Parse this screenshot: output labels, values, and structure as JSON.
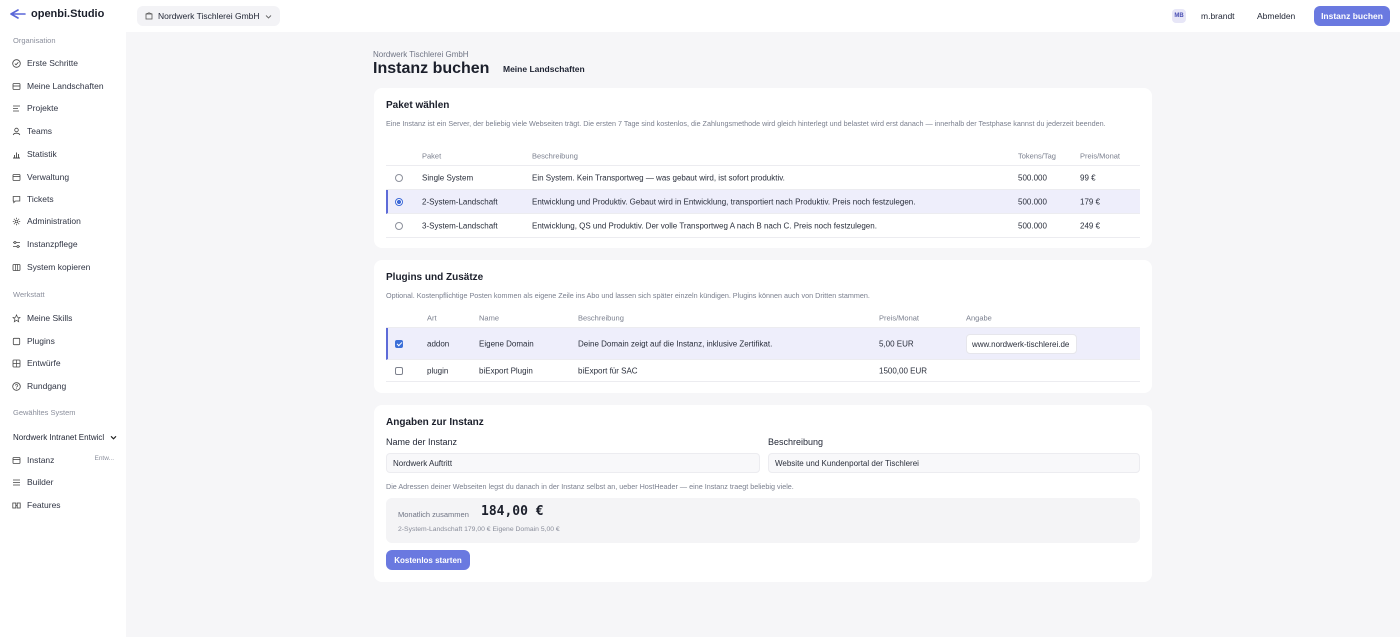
{
  "app": {
    "name": "openbi.Studio"
  },
  "topbar": {
    "org": "Nordwerk Tischlerei GmbH",
    "avatar": "MB",
    "user": "m.brandt",
    "logout": "Abmelden",
    "cta": "Instanz buchen"
  },
  "sidebar": {
    "section_org": "Organisation",
    "org_items": [
      {
        "label": "Erste Schritte",
        "icon": "check-circle-icon"
      },
      {
        "label": "Meine Landschaften",
        "icon": "layers-icon"
      },
      {
        "label": "Projekte",
        "icon": "list-icon"
      },
      {
        "label": "Teams",
        "icon": "user-icon"
      },
      {
        "label": "Statistik",
        "icon": "bar-chart-icon"
      },
      {
        "label": "Verwaltung",
        "icon": "window-icon"
      },
      {
        "label": "Tickets",
        "icon": "chat-icon"
      },
      {
        "label": "Administration",
        "icon": "gear-icon"
      },
      {
        "label": "Instanzpflege",
        "icon": "sliders-icon"
      },
      {
        "label": "System kopieren",
        "icon": "copy-icon"
      }
    ],
    "section_work": "Werkstatt",
    "work_items": [
      {
        "label": "Meine Skills",
        "icon": "star-icon"
      },
      {
        "label": "Plugins",
        "icon": "square-icon"
      },
      {
        "label": "Entwürfe",
        "icon": "grid-icon"
      },
      {
        "label": "Rundgang",
        "icon": "question-circle-icon"
      }
    ],
    "section_system": "Gewähltes System",
    "system_select": "Nordwerk Intranet Entwicl",
    "system_items": [
      {
        "label": "Instanz",
        "icon": "window-icon",
        "tag": "Entw..."
      },
      {
        "label": "Builder",
        "icon": "list-icon"
      },
      {
        "label": "Features",
        "icon": "features-icon"
      }
    ]
  },
  "header": {
    "breadcrumb": "Nordwerk Tischlerei GmbH",
    "title": "Instanz buchen",
    "tab": "Meine Landschaften"
  },
  "paket": {
    "title": "Paket wählen",
    "description": "Eine Instanz ist ein Server, der beliebig viele Webseiten trägt. Die ersten 7 Tage sind kostenlos, die Zahlungsmethode wird gleich hinterlegt und belastet wird erst danach — innerhalb der Testphase kannst du jederzeit beenden.",
    "columns": {
      "paket": "Paket",
      "beschreibung": "Beschreibung",
      "tokens": "Tokens/Tag",
      "preis": "Preis/Monat"
    },
    "rows": [
      {
        "name": "Single System",
        "beschreibung": "Ein System. Kein Transportweg — was gebaut wird, ist sofort produktiv.",
        "tokens": "500.000",
        "preis": "99 €",
        "selected": false
      },
      {
        "name": "2-System-Landschaft",
        "beschreibung": "Entwicklung und Produktiv. Gebaut wird in Entwicklung, transportiert nach Produktiv. Preis noch festzulegen.",
        "tokens": "500.000",
        "preis": "179 €",
        "selected": true
      },
      {
        "name": "3-System-Landschaft",
        "beschreibung": "Entwicklung, QS und Produktiv. Der volle Transportweg A nach B nach C. Preis noch festzulegen.",
        "tokens": "500.000",
        "preis": "249 €",
        "selected": false
      }
    ]
  },
  "plugins": {
    "title": "Plugins und Zusätze",
    "description": "Optional. Kostenpflichtige Posten kommen als eigene Zeile ins Abo und lassen sich später einzeln kündigen. Plugins können auch von Dritten stammen.",
    "columns": {
      "art": "Art",
      "name": "Name",
      "beschreibung": "Beschreibung",
      "preis": "Preis/Monat",
      "angabe": "Angabe"
    },
    "rows": [
      {
        "art": "addon",
        "name": "Eigene Domain",
        "beschreibung": "Deine Domain zeigt auf die Instanz, inklusive Zertifikat.",
        "preis": "5,00 EUR",
        "angabe": "www.nordwerk-tischlerei.de",
        "checked": true
      },
      {
        "art": "plugin",
        "name": "biExport Plugin",
        "beschreibung": "biExport für SAC",
        "preis": "1500,00 EUR",
        "angabe": "",
        "checked": false
      }
    ]
  },
  "instanz": {
    "title": "Angaben zur Instanz",
    "name_label": "Name der Instanz",
    "name_value": "Nordwerk Auftritt",
    "desc_label": "Beschreibung",
    "desc_value": "Website und Kundenportal der Tischlerei",
    "hint": "Die Adressen deiner Webseiten legst du danach in der Instanz selbst an, ueber HostHeader — eine Instanz traegt beliebig viele.",
    "summary_label": "Monatlich zusammen",
    "summary_total": "184,00 €",
    "summary_lines": "2-System-Landschaft 179,00 €   Eigene Domain 5,00 €",
    "start_button": "Kostenlos starten"
  }
}
